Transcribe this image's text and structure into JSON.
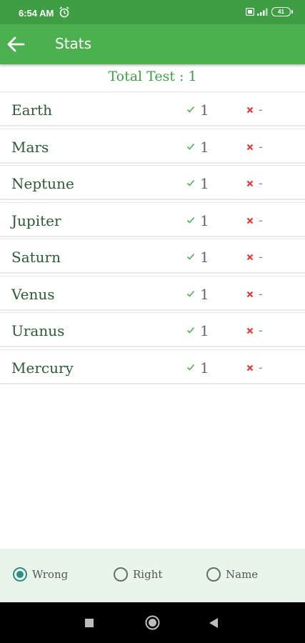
{
  "status": {
    "time": "6:54 AM",
    "battery": "41"
  },
  "appbar": {
    "title": "Stats"
  },
  "summary": {
    "total_label": "Total Test : 1"
  },
  "rows": [
    {
      "name": "Earth",
      "right": "1",
      "wrong": "-"
    },
    {
      "name": "Mars",
      "right": "1",
      "wrong": "-"
    },
    {
      "name": "Neptune",
      "right": "1",
      "wrong": "-"
    },
    {
      "name": "Jupiter",
      "right": "1",
      "wrong": "-"
    },
    {
      "name": "Saturn",
      "right": "1",
      "wrong": "-"
    },
    {
      "name": "Venus",
      "right": "1",
      "wrong": "-"
    },
    {
      "name": "Uranus",
      "right": "1",
      "wrong": "-"
    },
    {
      "name": "Mercury",
      "right": "1",
      "wrong": "-"
    }
  ],
  "sort": {
    "options": [
      "Wrong",
      "Right",
      "Name"
    ],
    "selected": "Wrong"
  },
  "colors": {
    "status_bar": "#3f9e44",
    "app_bar": "#4caf50",
    "accent": "#3c9f44",
    "check": "#4caf50",
    "cross": "#e53935",
    "radio_selected": "#2f8f82",
    "bottom_panel": "#e9f5ea"
  },
  "icons": {
    "back": "arrow-left-icon",
    "right": "check-icon",
    "wrong": "x-icon",
    "alarm": "alarm-clock-icon"
  }
}
